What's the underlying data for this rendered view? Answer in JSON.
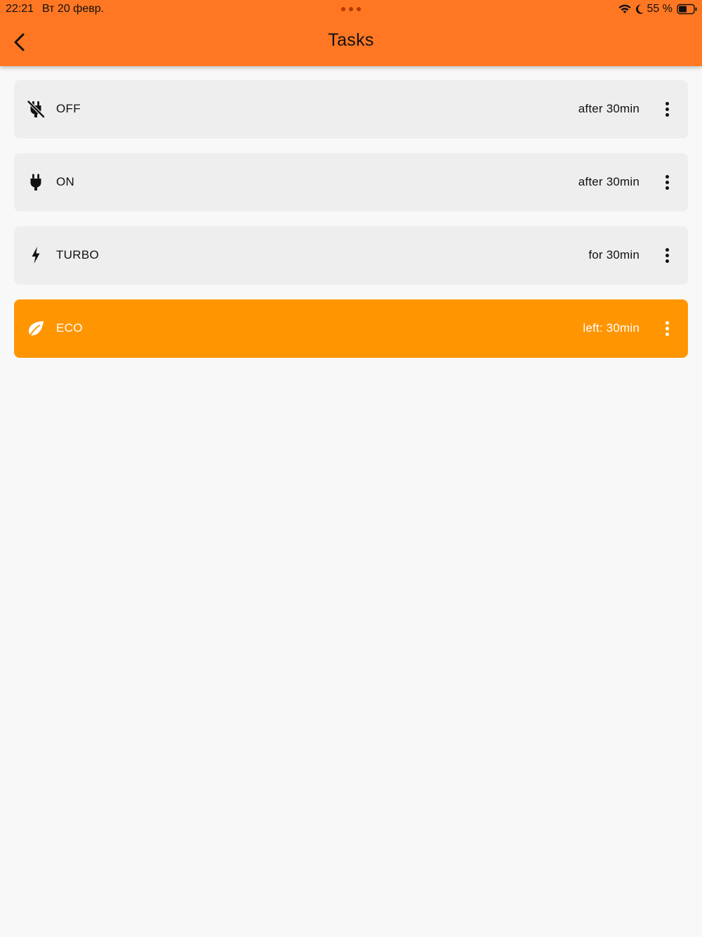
{
  "status_bar": {
    "time": "22:21",
    "date": "Вт 20 февр.",
    "battery": "55 %"
  },
  "app_bar": {
    "title": "Tasks",
    "color": "#ff7722"
  },
  "tasks": [
    {
      "icon": "power-plug-off-icon",
      "label": "OFF",
      "time": "after 30min",
      "active": false
    },
    {
      "icon": "power-plug-icon",
      "label": "ON",
      "time": "after 30min",
      "active": false
    },
    {
      "icon": "lightning-bolt-icon",
      "label": "TURBO",
      "time": "for 30min",
      "active": false
    },
    {
      "icon": "leaf-icon",
      "label": "ECO",
      "time": "left: 30min",
      "active": true
    }
  ],
  "colors": {
    "card": "#eeeeee",
    "active_card": "#ff9500",
    "background": "#f8f8f8"
  }
}
